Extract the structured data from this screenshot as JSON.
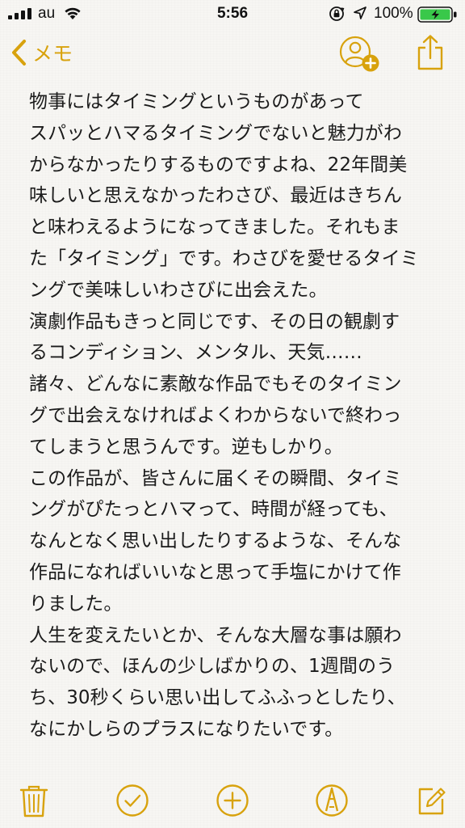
{
  "status_bar": {
    "carrier": "au",
    "time": "5:56",
    "battery_percent": "100%",
    "icons": [
      "signal-bars-icon",
      "wifi-icon",
      "rotation-lock-icon",
      "location-arrow-icon",
      "battery-charging-icon"
    ]
  },
  "nav": {
    "back_label": "メモ",
    "back_icon": "chevron-left-icon",
    "add_people_icon": "add-person-icon",
    "share_icon": "share-icon"
  },
  "note": {
    "lines": [
      "物事にはタイミングというものがあって",
      "スパッとハマるタイミングでないと魅力がわ",
      "からなかったりするものですよね、22年間美",
      "味しいと思えなかったわさび、最近はきちん",
      "と味わえるようになってきました。それもま",
      "た「タイミング」です。わさびを愛せるタイミ",
      "ングで美味しいわさびに出会えた。",
      "演劇作品もきっと同じです、その日の観劇す",
      "るコンディション、メンタル、天気……",
      "諸々、どんなに素敵な作品でもそのタイミン",
      "グで出会えなければよくわからないで終わっ",
      "てしまうと思うんです。逆もしかり。",
      "この作品が、皆さんに届くその瞬間、タイミ",
      "ングがぴたっとハマって、時間が経っても、",
      "なんとなく思い出したりするような、そんな",
      "作品になればいいなと思って手塩にかけて作",
      "りました。",
      "人生を変えたいとか、そんな大層な事は願わ",
      "ないので、ほんの少しばかりの、1週間のう",
      "ち、30秒くらい思い出してふふっとしたり、",
      "なにかしらのプラスになりたいです。"
    ]
  },
  "toolbar": {
    "icons": [
      "trash-icon",
      "checklist-icon",
      "add-icon",
      "sketch-icon",
      "compose-icon"
    ]
  },
  "colors": {
    "accent": "#d8a20d",
    "text": "#1b1b1b",
    "background": "#f7f6f3"
  }
}
